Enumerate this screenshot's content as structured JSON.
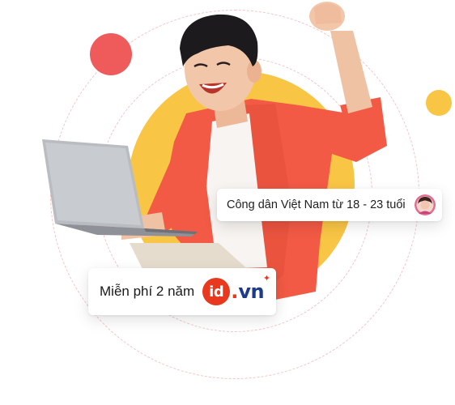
{
  "colors": {
    "accent_red": "#ef5b5b",
    "accent_yellow": "#f9c544",
    "dash_pink": "#f3b2b2",
    "shirt": "#f25a45",
    "logo_red": "#e8381e",
    "logo_blue": "#1e3a8a"
  },
  "badges": {
    "citizen": {
      "text": "Công dân Việt Nam từ 18 - 23 tuổi",
      "icon": "avatar-icon"
    },
    "free": {
      "text": "Miễn phí 2 năm",
      "logo_mark": "id",
      "logo_dot": ".",
      "logo_tld": "vn"
    }
  }
}
